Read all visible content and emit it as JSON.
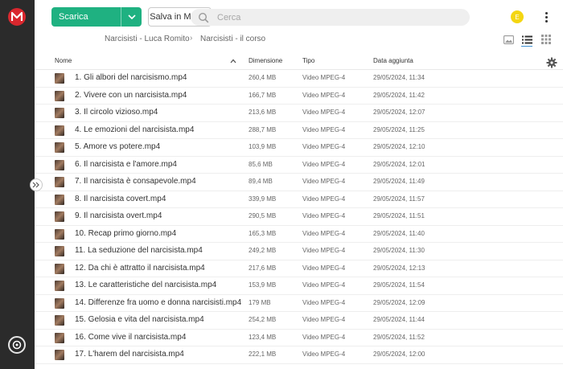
{
  "app": {
    "logo": "mega-logo-icon",
    "brand_color": "#d9272e",
    "accent_color": "#1fb181"
  },
  "toolbar": {
    "download_label": "Scarica",
    "save_label": "Salva in MEGA",
    "search_placeholder": "Cerca",
    "user_initial": "E"
  },
  "breadcrumb": {
    "items": [
      "Narcisisti - Luca Romito",
      "Narcisisti - il corso"
    ]
  },
  "table": {
    "columns": [
      "Nome",
      "Dimensione",
      "Tipo",
      "Data aggiunta"
    ],
    "rows": [
      {
        "name": "1. Gli albori del narcisismo.mp4",
        "size": "260,4 MB",
        "type": "Video MPEG-4",
        "date": "29/05/2024, 11:34"
      },
      {
        "name": "2. Vivere con un narcisista.mp4",
        "size": "166,7 MB",
        "type": "Video MPEG-4",
        "date": "29/05/2024, 11:42"
      },
      {
        "name": "3. Il circolo vizioso.mp4",
        "size": "213,6 MB",
        "type": "Video MPEG-4",
        "date": "29/05/2024, 12:07"
      },
      {
        "name": "4. Le emozioni del narcisista.mp4",
        "size": "288,7 MB",
        "type": "Video MPEG-4",
        "date": "29/05/2024, 11:25"
      },
      {
        "name": "5. Amore vs potere.mp4",
        "size": "103,9 MB",
        "type": "Video MPEG-4",
        "date": "29/05/2024, 12:10"
      },
      {
        "name": "6. Il narcisista e l'amore.mp4",
        "size": "85,6 MB",
        "type": "Video MPEG-4",
        "date": "29/05/2024, 12:01"
      },
      {
        "name": "7. Il narcisista è consapevole.mp4",
        "size": "89,4 MB",
        "type": "Video MPEG-4",
        "date": "29/05/2024, 11:49"
      },
      {
        "name": "8. Il narcisista covert.mp4",
        "size": "339,9 MB",
        "type": "Video MPEG-4",
        "date": "29/05/2024, 11:57"
      },
      {
        "name": "9. Il narcisista overt.mp4",
        "size": "290,5 MB",
        "type": "Video MPEG-4",
        "date": "29/05/2024, 11:51"
      },
      {
        "name": "10. Recap primo giorno.mp4",
        "size": "165,3 MB",
        "type": "Video MPEG-4",
        "date": "29/05/2024, 11:40"
      },
      {
        "name": "11. La seduzione del narcisista.mp4",
        "size": "249,2 MB",
        "type": "Video MPEG-4",
        "date": "29/05/2024, 11:30"
      },
      {
        "name": "12. Da chi è attratto il narcisista.mp4",
        "size": "217,6 MB",
        "type": "Video MPEG-4",
        "date": "29/05/2024, 12:13"
      },
      {
        "name": "13. Le caratteristiche del narcisista.mp4",
        "size": "153,9 MB",
        "type": "Video MPEG-4",
        "date": "29/05/2024, 11:54"
      },
      {
        "name": "14. Differenze fra uomo e donna narcisisti.mp4",
        "size": "179 MB",
        "type": "Video MPEG-4",
        "date": "29/05/2024, 12:09"
      },
      {
        "name": "15. Gelosia e vita del narcisista.mp4",
        "size": "254,2 MB",
        "type": "Video MPEG-4",
        "date": "29/05/2024, 11:44"
      },
      {
        "name": "16. Come vive il narcisista.mp4",
        "size": "123,4 MB",
        "type": "Video MPEG-4",
        "date": "29/05/2024, 11:52"
      },
      {
        "name": "17. L'harem del narcisista.mp4",
        "size": "222,1 MB",
        "type": "Video MPEG-4",
        "date": "29/05/2024, 12:00"
      }
    ]
  }
}
